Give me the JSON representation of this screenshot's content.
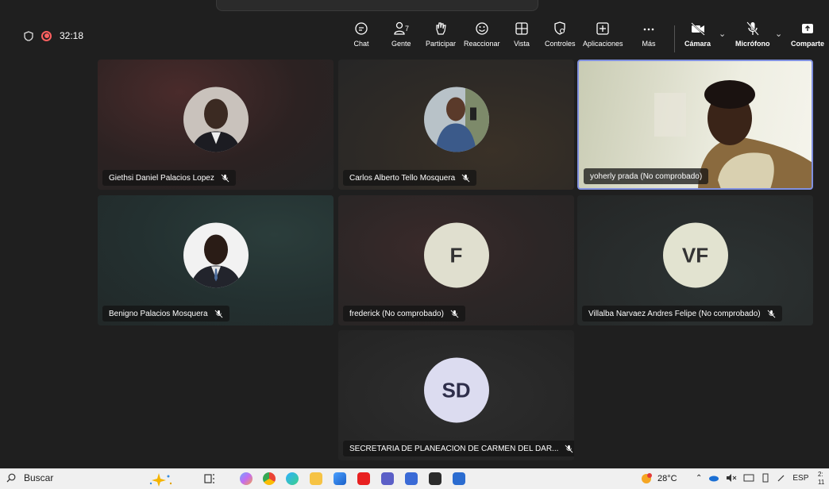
{
  "meeting": {
    "timer": "32:18"
  },
  "toolbar": {
    "chat": "Chat",
    "people": "Gente",
    "people_count": "7",
    "raise": "Participar",
    "react": "Reaccionar",
    "view": "Vista",
    "controls": "Controles",
    "apps": "Aplicaciones",
    "more": "Más",
    "camera": "Cámara",
    "mic": "Micrófono",
    "share": "Comparte"
  },
  "participants": [
    {
      "name": "Giethsi Daniel Palacios Lopez",
      "muted": true
    },
    {
      "name": "Carlos Alberto Tello Mosquera",
      "muted": true
    },
    {
      "name": "yoherly prada (No comprobado)",
      "muted": false
    },
    {
      "name": "Benigno Palacios Mosquera",
      "muted": true
    },
    {
      "name": "frederick (No comprobado)",
      "muted": true,
      "initials": "F"
    },
    {
      "name": "Villalba Narvaez Andres Felipe (No comprobado)",
      "muted": true,
      "initials": "VF"
    },
    {
      "name": "SECRETARIA DE PLANEACION DE CARMEN DEL DAR...",
      "muted": true,
      "initials": "SD"
    }
  ],
  "taskbar": {
    "search": "Buscar",
    "temperature": "28°C",
    "language": "ESP",
    "clock_top": "2:",
    "clock_bottom": "11"
  },
  "colors": {
    "accent": "#8090e0",
    "recording": "#ff6060",
    "background": "#1f1f1f"
  }
}
